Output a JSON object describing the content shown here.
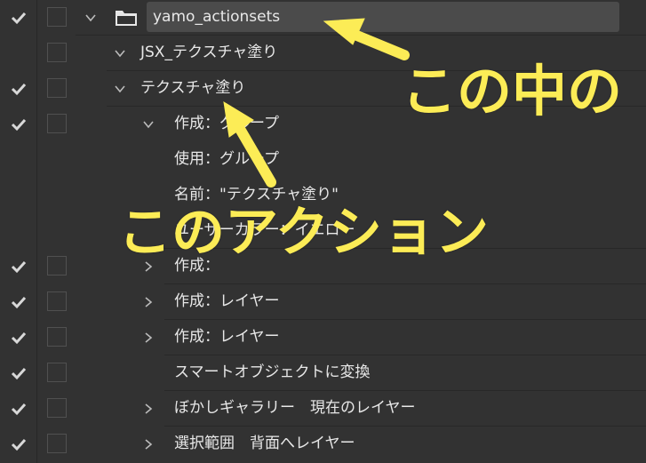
{
  "colors": {
    "background": "#323232",
    "selection": "#4b4b4b",
    "text": "#e8e8e8",
    "annotation": "#fcec56"
  },
  "rows": [
    {
      "label": "yamo_actionsets",
      "checked": true,
      "icon": "folder-icon",
      "expander": "chevron-down-icon"
    },
    {
      "label": "JSX_テクスチャ塗り",
      "checked": false,
      "expander": "chevron-down-icon"
    },
    {
      "label": "テクスチャ塗り",
      "checked": true,
      "expander": "chevron-down-icon"
    },
    {
      "label": "作成：グループ",
      "checked": true,
      "expander": "chevron-down-icon"
    },
    {
      "label": "使用：グループ",
      "checked": false
    },
    {
      "label": "名前：\"テクスチャ塗り\"",
      "checked": false
    },
    {
      "label": "ユーザーカラー：イエロー",
      "checked": false
    },
    {
      "label": "作成：",
      "checked": true,
      "expander": "chevron-right-icon"
    },
    {
      "label": "作成：レイヤー",
      "checked": true,
      "expander": "chevron-right-icon"
    },
    {
      "label": "作成：レイヤー",
      "checked": true,
      "expander": "chevron-right-icon"
    },
    {
      "label": "スマートオブジェクトに変換",
      "checked": true
    },
    {
      "label": "ぼかしギャラリー　現在のレイヤー",
      "checked": true,
      "expander": "chevron-right-icon"
    },
    {
      "label": "選択範囲　背面へレイヤー",
      "checked": true,
      "expander": "chevron-right-icon"
    }
  ],
  "annotations": {
    "inside": "この中の",
    "action": "このアクション"
  }
}
